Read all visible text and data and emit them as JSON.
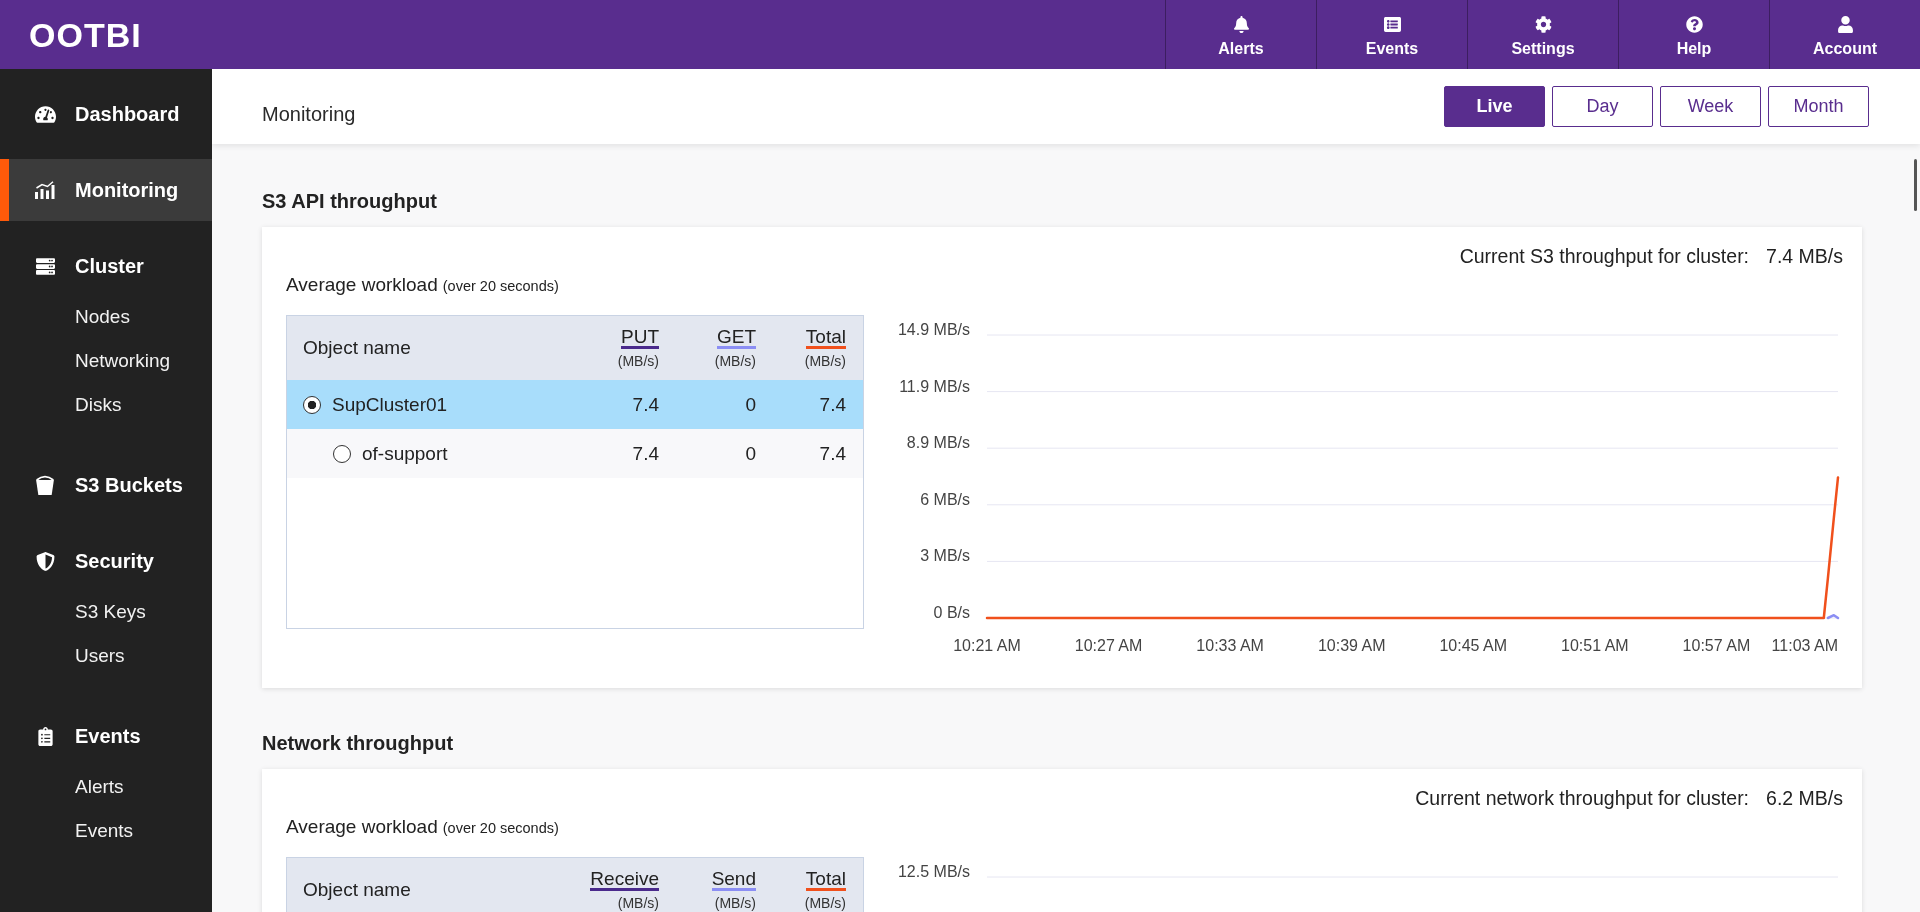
{
  "header": {
    "logo": "OOTBI",
    "nav": [
      {
        "label": "Alerts"
      },
      {
        "label": "Events"
      },
      {
        "label": "Settings"
      },
      {
        "label": "Help"
      },
      {
        "label": "Account"
      }
    ]
  },
  "sidebar": {
    "items": [
      {
        "label": "Dashboard",
        "selected": false
      },
      {
        "label": "Monitoring",
        "selected": true
      },
      {
        "label": "Cluster",
        "selected": false,
        "children": [
          {
            "label": "Nodes",
            "selected": false
          },
          {
            "label": "Networking",
            "selected": false
          },
          {
            "label": "Disks",
            "selected": false
          }
        ]
      },
      {
        "label": "S3 Buckets",
        "selected": false
      },
      {
        "label": "Security",
        "selected": false,
        "children": [
          {
            "label": "S3 Keys",
            "selected": false
          },
          {
            "label": "Users",
            "selected": false
          }
        ]
      },
      {
        "label": "Events",
        "selected": false,
        "children": [
          {
            "label": "Alerts",
            "selected": false
          },
          {
            "label": "Events",
            "selected": false
          }
        ]
      }
    ]
  },
  "toolbar": {
    "title": "Monitoring",
    "ranges": [
      {
        "label": "Live",
        "selected": true
      },
      {
        "label": "Day",
        "selected": false
      },
      {
        "label": "Week",
        "selected": false
      },
      {
        "label": "Month",
        "selected": false
      }
    ]
  },
  "sections": [
    {
      "title": "S3 API throughput",
      "current": {
        "label": "Current S3 throughput for cluster:",
        "value": "7.4 MB/s"
      },
      "workload": {
        "title": "Average workload",
        "note": "(over 20 seconds)"
      },
      "table": {
        "columns": [
          {
            "label": "Object name"
          },
          {
            "label": "PUT",
            "unit": "(MB/s)",
            "color": "#4a2a8c"
          },
          {
            "label": "GET",
            "unit": "(MB/s)",
            "color": "#8b8ef4"
          },
          {
            "label": "Total",
            "unit": "(MB/s)",
            "color": "#f0501c"
          }
        ],
        "rows": [
          {
            "name": "SupCluster01",
            "selected": true,
            "values": [
              "7.4",
              "0",
              "7.4"
            ],
            "children": [
              {
                "name": "of-support",
                "selected": false,
                "values": [
                  "7.4",
                  "0",
                  "7.4"
                ]
              }
            ]
          }
        ]
      },
      "chart_data": {
        "type": "line",
        "grid": true,
        "x": [
          621,
          627,
          633,
          639,
          645,
          651,
          657,
          662.3,
          662.5,
          662.8,
          663
        ],
        "series": [
          {
            "color": "#8b8ef4",
            "values": [
              null,
              null,
              null,
              null,
              null,
              null,
              null,
              null,
              0,
              0.15,
              0
            ]
          },
          {
            "color": "#f0501c",
            "values": [
              0,
              0,
              0,
              0,
              0,
              0,
              0,
              0,
              2.1,
              5.3,
              7.4
            ]
          }
        ],
        "xlim": [
          621,
          663
        ],
        "ylim": [
          0,
          14.9
        ],
        "xticks": [
          {
            "value": 621,
            "label": "10:21 AM"
          },
          {
            "value": 627,
            "label": "10:27 AM"
          },
          {
            "value": 633,
            "label": "10:33 AM"
          },
          {
            "value": 639,
            "label": "10:39 AM"
          },
          {
            "value": 645,
            "label": "10:45 AM"
          },
          {
            "value": 651,
            "label": "10:51 AM"
          },
          {
            "value": 657,
            "label": "10:57 AM"
          },
          {
            "value": 663,
            "label": "11:03 AM"
          }
        ],
        "yticks": [
          {
            "value": 0,
            "label": "0 B/s"
          },
          {
            "value": 2.98,
            "label": "3 MB/s"
          },
          {
            "value": 5.96,
            "label": "6 MB/s"
          },
          {
            "value": 8.94,
            "label": "8.9 MB/s"
          },
          {
            "value": 11.92,
            "label": "11.9 MB/s"
          },
          {
            "value": 14.9,
            "label": "14.9 MB/s"
          }
        ]
      }
    },
    {
      "title": "Network throughput",
      "current": {
        "label": "Current network throughput for cluster:",
        "value": "6.2 MB/s"
      },
      "workload": {
        "title": "Average workload",
        "note": "(over 20 seconds)"
      },
      "table": {
        "columns": [
          {
            "label": "Object name"
          },
          {
            "label": "Receive",
            "unit": "(MB/s)",
            "color": "#4a2a8c"
          },
          {
            "label": "Send",
            "unit": "(MB/s)",
            "color": "#8b8ef4"
          },
          {
            "label": "Total",
            "unit": "(MB/s)",
            "color": "#f0501c"
          }
        ]
      },
      "chart": {
        "y_axis_labels": [
          "12.5 MB/s"
        ]
      }
    }
  ]
}
